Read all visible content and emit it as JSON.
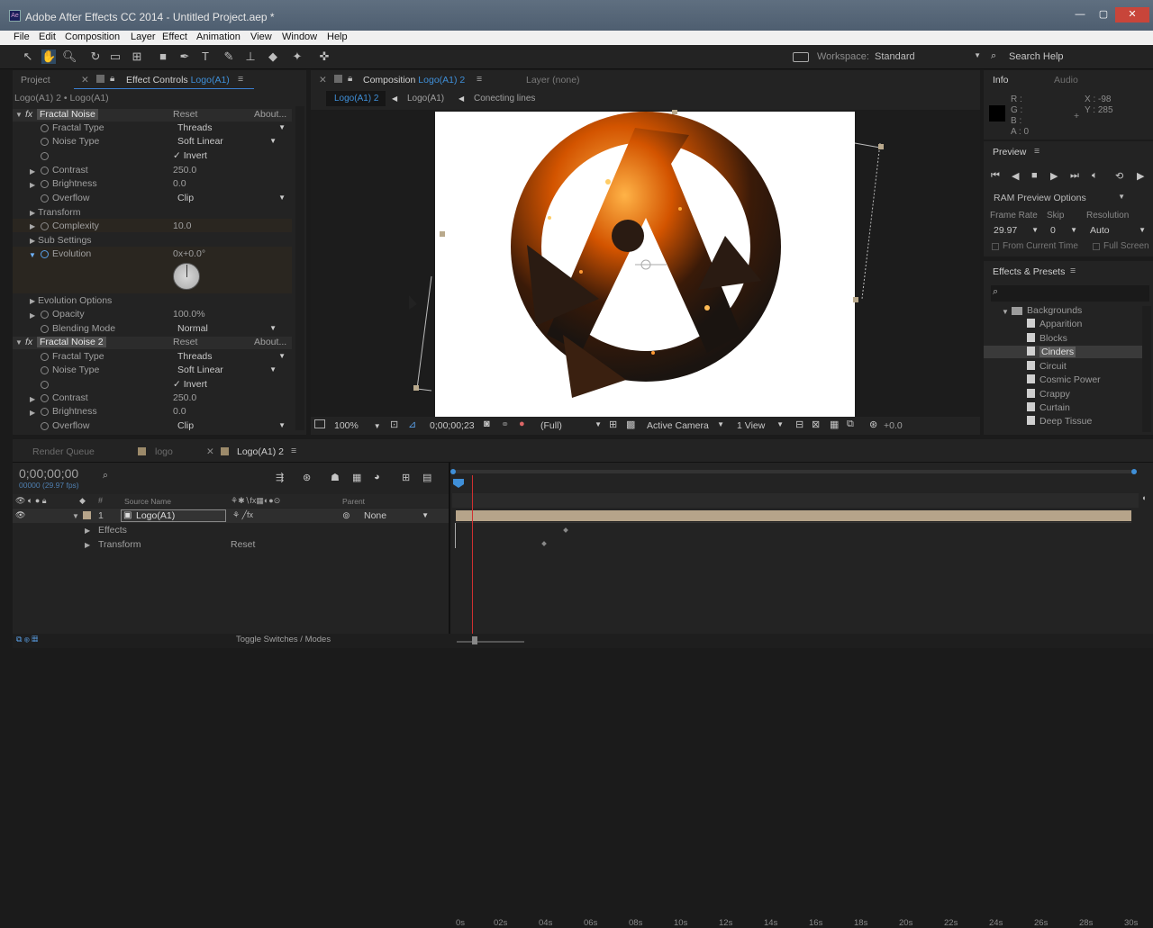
{
  "app": {
    "title": "Adobe After Effects CC 2014 - Untitled Project.aep *"
  },
  "window_controls": {
    "minimize": "—",
    "maximize": "▢",
    "close": "✕"
  },
  "menu": [
    "File",
    "Edit",
    "Composition",
    "Layer",
    "Effect",
    "Animation",
    "View",
    "Window",
    "Help"
  ],
  "toolbar": {
    "workspace_label": "Workspace:",
    "workspace_value": "Standard",
    "search_help": "Search Help"
  },
  "left_panel": {
    "tab_project": "Project",
    "tab_effect_controls": "Effect Controls",
    "tab_layer_name": "Logo(A1)",
    "breadcrumb": "Logo(A1) 2 • Logo(A1)",
    "reset": "Reset",
    "about": "About...",
    "fx1": {
      "name": "Fractal Noise",
      "fractal_type_label": "Fractal Type",
      "fractal_type": "Threads",
      "noise_type_label": "Noise Type",
      "noise_type": "Soft Linear",
      "invert": "Invert",
      "contrast_label": "Contrast",
      "contrast": "250.0",
      "brightness_label": "Brightness",
      "brightness": "0.0",
      "overflow_label": "Overflow",
      "overflow": "Clip",
      "transform": "Transform",
      "complexity_label": "Complexity",
      "complexity": "10.0",
      "sub_settings": "Sub Settings",
      "evolution_label": "Evolution",
      "evolution": "0x+0.0°",
      "evolution_options": "Evolution Options",
      "opacity_label": "Opacity",
      "opacity": "100.0%",
      "blending_label": "Blending Mode",
      "blending": "Normal"
    },
    "fx2": {
      "name": "Fractal Noise 2",
      "fractal_type_label": "Fractal Type",
      "fractal_type": "Threads",
      "noise_type_label": "Noise Type",
      "noise_type": "Soft Linear",
      "invert": "Invert",
      "contrast_label": "Contrast",
      "contrast": "250.0",
      "brightness_label": "Brightness",
      "brightness": "0.0",
      "overflow_label": "Overflow",
      "overflow": "Clip"
    }
  },
  "comp_panel": {
    "tab_composition": "Composition",
    "comp_name": "Logo(A1) 2",
    "layer_tab": "Layer (none)",
    "crumbs": [
      "Logo(A1) 2",
      "Logo(A1)",
      "Conecting lines"
    ],
    "zoom": "100%",
    "timecode": "0;00;00;23",
    "resolution": "(Full)",
    "camera": "Active Camera",
    "view": "1 View",
    "exposure": "+0.0"
  },
  "info": {
    "tab_info": "Info",
    "tab_audio": "Audio",
    "r": "R :",
    "g": "G :",
    "b": "B :",
    "a": "A : 0",
    "x": "X : -98",
    "y": "Y : 285"
  },
  "preview": {
    "title": "Preview",
    "ram": "RAM Preview Options",
    "frame_rate_label": "Frame Rate",
    "frame_rate": "29.97",
    "skip_label": "Skip",
    "skip": "0",
    "resolution_label": "Resolution",
    "resolution": "Auto",
    "from_current": "From Current Time",
    "full_screen": "Full Screen"
  },
  "effects_presets": {
    "title": "Effects & Presets",
    "search_placeholder": "",
    "folder": "Backgrounds",
    "items": [
      "Apparition",
      "Blocks",
      "Cinders",
      "Circuit",
      "Cosmic Power",
      "Crappy",
      "Curtain",
      "Deep Tissue"
    ],
    "selected": "Cinders"
  },
  "timeline": {
    "tab_render_queue": "Render Queue",
    "tab_logo": "logo",
    "tab_active": "Logo(A1) 2",
    "timecode": "0;00;00;00",
    "fps": "00000 (29.97 fps)",
    "col_source": "Source Name",
    "col_parent": "Parent",
    "layer_num": "1",
    "layer_name": "Logo(A1)",
    "parent_value": "None",
    "effects": "Effects",
    "transform": "Transform",
    "reset": "Reset",
    "ticks": [
      "0s",
      "02s",
      "04s",
      "06s",
      "08s",
      "10s",
      "12s",
      "14s",
      "16s",
      "18s",
      "20s",
      "22s",
      "24s",
      "26s",
      "28s",
      "30s"
    ],
    "toggle": "Toggle Switches / Modes"
  },
  "colors": {
    "accent_blue": "#3f8fd8",
    "timeline_bar": "#b6a48a",
    "playhead": "#d03030"
  }
}
